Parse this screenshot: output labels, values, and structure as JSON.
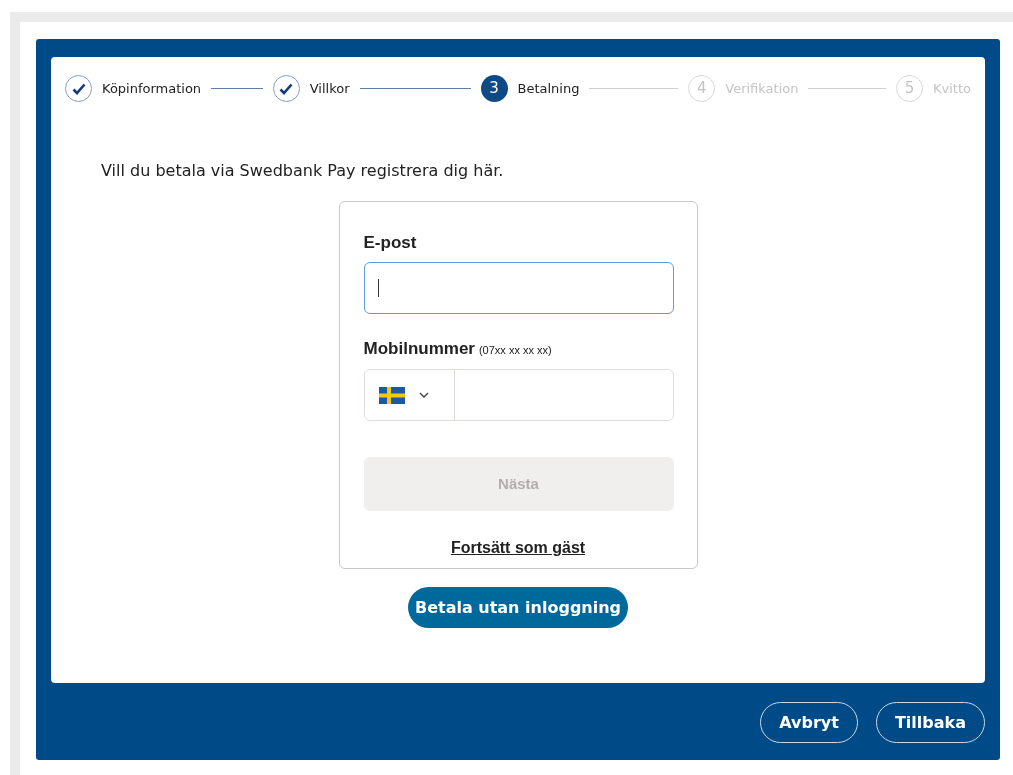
{
  "steps": [
    {
      "label": "Köpinformation",
      "kind": "done"
    },
    {
      "label": "Villkor",
      "kind": "done"
    },
    {
      "number": "3",
      "label": "Betalning",
      "kind": "current"
    },
    {
      "number": "4",
      "label": "Verifikation",
      "kind": "upcoming"
    },
    {
      "number": "5",
      "label": "Kvitto",
      "kind": "upcoming"
    }
  ],
  "intro": "Vill du betala via Swedbank Pay registrera dig här.",
  "form": {
    "email_label": "E-post",
    "email_focused": true,
    "phone_label": "Mobilnummer",
    "phone_hint": "(07xx xx xx xx)",
    "next_button": {
      "label": "Nästa",
      "disabled": true
    },
    "guest_link": "Fortsätt som gäst"
  },
  "pay_button": "Betala utan inloggning",
  "footer_buttons": [
    "Avbryt",
    "Tillbaka"
  ]
}
